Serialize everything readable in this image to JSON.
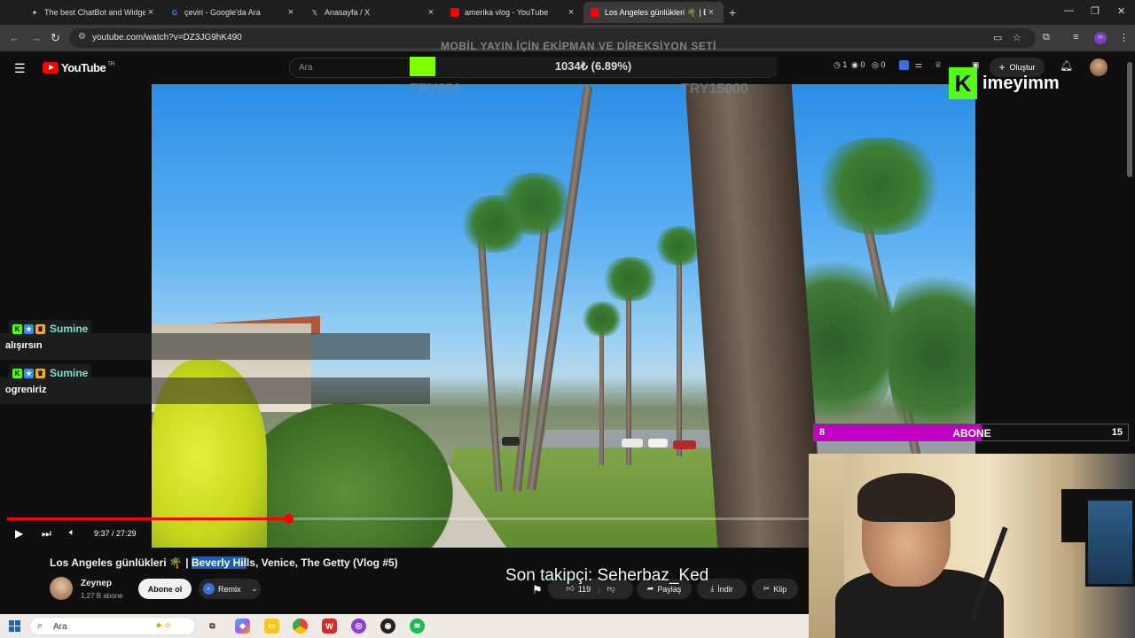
{
  "browser": {
    "tabs": [
      {
        "title": "The best ChatBot and Widgets f",
        "active": false
      },
      {
        "title": "çeviri - Google'da Ara",
        "active": false
      },
      {
        "title": "Anasayfa / X",
        "active": false
      },
      {
        "title": "amerika vlog - YouTube",
        "active": false
      },
      {
        "title": "Los Angeles günlükleri 🌴 | Bev",
        "active": true
      }
    ],
    "url": "youtube.com/watch?v=DZ3JG9hK490"
  },
  "youtube": {
    "logo_text": "YouTube",
    "country": "TR",
    "search_placeholder": "Ara",
    "notif_counts": [
      "1",
      "0",
      "0"
    ],
    "create_label": "Oluştur"
  },
  "player": {
    "time": "9:37 / 27:29",
    "progress": 0.3505
  },
  "video": {
    "title_before": "Los Angeles günlükleri 🌴 | ",
    "title_highlight": "Beverly Hil",
    "title_after": "ls, Venice, The Getty (Vlog #5)",
    "channel_name": "Zeynep",
    "channel_subs": "1,27 B abone",
    "subscribe_label": "Abone ol",
    "remix_label": "Remix",
    "like_count": "119",
    "share_label": "Paylaş",
    "download_label": "İndir",
    "clip_label": "Klip"
  },
  "overlay": {
    "goal_title": "MOBİL YAYIN İÇİN EKİPMAN VE DİREKSİYON SETİ",
    "goal_text": "1034₺ (6.89%)",
    "goal_progress": 0.0689,
    "goal_min": "TRY981",
    "goal_max": "TRY15000",
    "kick_name": "imeyimm",
    "chat": [
      {
        "user": "Sumine",
        "message": "alışırsın"
      },
      {
        "user": "Sumine",
        "message": "ogreniriz"
      }
    ],
    "sub_current": "8",
    "sub_label": "ABONE",
    "sub_max": "15",
    "sub_progress": 0.5333,
    "last_follower": "Son takipçi: Seherbaz_Ked"
  },
  "taskbar": {
    "search_text": "Ara"
  },
  "colors": {
    "accent_red": "#ff0000",
    "kick_green": "#53fc18",
    "goal_green": "#7cff00",
    "sub_purple": "#c200c2"
  }
}
